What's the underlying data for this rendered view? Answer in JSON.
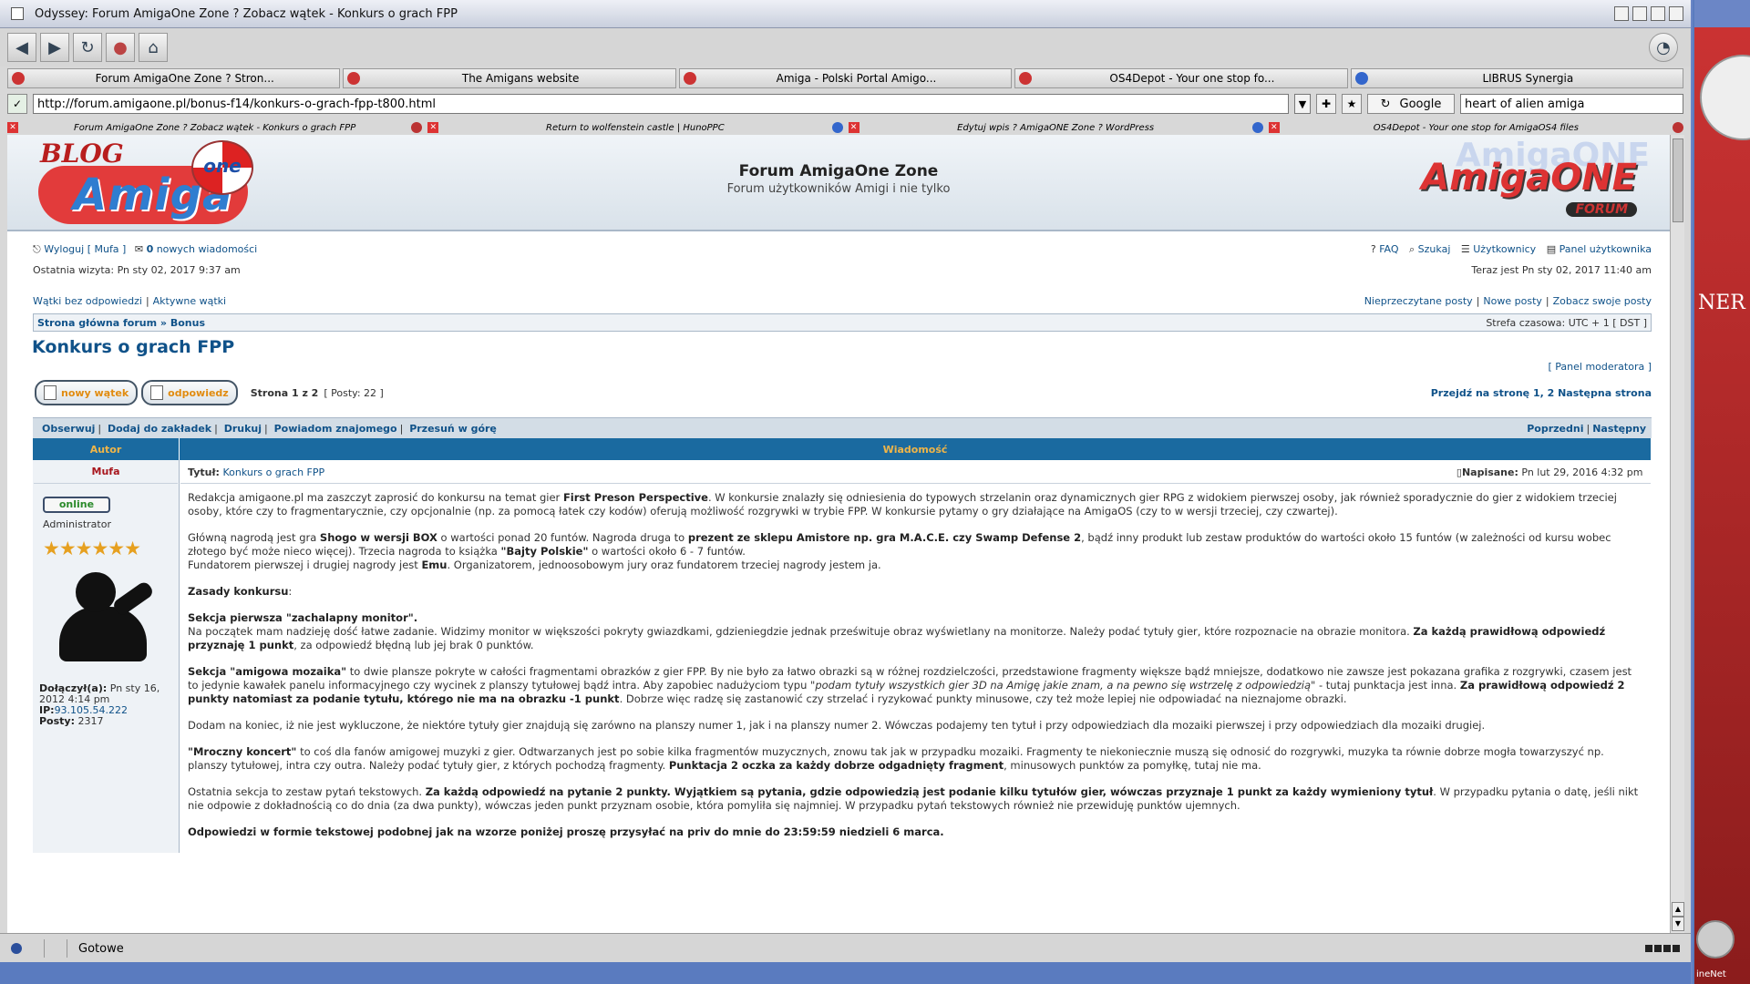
{
  "window": {
    "title": "Odyssey: Forum AmigaOne Zone ? Zobacz wątek - Konkurs o grach FPP"
  },
  "tabs": [
    {
      "label": "Forum AmigaOne Zone ? Stron...",
      "icon": "amiga-ball-icon"
    },
    {
      "label": "The Amigans website",
      "icon": "amiga-ball-icon"
    },
    {
      "label": "Amiga - Polski Portal Amigo...",
      "icon": "ppa-icon"
    },
    {
      "label": "OS4Depot - Your one stop fo...",
      "icon": "amiga-ball-icon"
    },
    {
      "label": "LIBRUS Synergia",
      "icon": "globe-icon"
    }
  ],
  "address": {
    "url": "http://forum.amigaone.pl/bonus-f14/konkurs-o-grach-fpp-t800.html",
    "search_engine": "Google",
    "search_query": "heart of alien amiga"
  },
  "subtabs": [
    {
      "label": "Forum AmigaOne Zone ? Zobacz wątek - Konkurs o grach FPP"
    },
    {
      "label": "Return to wolfenstein castle | HunoPPC"
    },
    {
      "label": "Edytuj wpis ? AmigaONE Zone ? WordPress"
    },
    {
      "label": "OS4Depot - Your one stop for AmigaOS4 files"
    }
  ],
  "header": {
    "logo_left_blog": "BLOG",
    "logo_left_one": "one",
    "logo_left_amiga": "Amiga",
    "site_title": "Forum AmigaOne Zone",
    "site_desc": "Forum użytkowników Amigi i nie tylko",
    "logo_right": "AmigaONE",
    "logo_right_ghost": "AmigaONE",
    "logo_right_forum": "FORUM"
  },
  "nav": {
    "logout": "Wyloguj [ Mufa ]",
    "new_count": "0",
    "new_messages": " nowych wiadomości",
    "faq": "FAQ",
    "search": "Szukaj",
    "members": "Użytkownicy",
    "ucp": "Panel użytkownika",
    "last_visit": "Ostatnia wizyta: Pn sty 02, 2017 9:37 am",
    "now": "Teraz jest Pn sty 02, 2017 11:40 am",
    "unanswered": "Wątki bez odpowiedzi",
    "active": "Aktywne wątki",
    "unread": "Nieprzeczytane posty",
    "new_posts": "Nowe posty",
    "own_posts": "Zobacz swoje posty",
    "crumb_home": "Strona główna forum",
    "crumb_sep": " » ",
    "crumb_forum": "Bonus",
    "timezone": "Strefa czasowa: UTC + 1 [ DST ]"
  },
  "topic": {
    "title": "Konkurs o grach FPP",
    "mod_panel": "[ Panel moderatora ]",
    "btn_new": "nowy wątek",
    "btn_reply": "odpowiedz",
    "page_status": "Strona 1 z 2",
    "posts": "[ Posty: 22 ]",
    "goto_page": "Przejdź na stronę 1, 2  Następna strona",
    "actions": [
      "Obserwuj",
      "Dodaj do zakładek",
      "Drukuj",
      "Powiadom znajomego",
      "Przesuń w górę"
    ],
    "prev": "Poprzedni",
    "next": "Następny"
  },
  "post": {
    "col_author": "Autor",
    "col_message": "Wiadomość",
    "author": "Mufa",
    "online": "online",
    "rank": "Administrator",
    "stars": "★★★★★★",
    "joined_label": "Dołączył(a):",
    "joined_value": "Pn sty 16, 2012 4:14 pm",
    "ip_label": "IP:",
    "ip_value": "93.105.54.222",
    "posts_label": "Posty:",
    "posts_value": "2317",
    "subject_label": "Tytuł:",
    "subject": "Konkurs o grach FPP",
    "posted_label": "Napisane:",
    "posted": "Pn lut 29, 2016 4:32 pm",
    "p1a": "Redakcja amigaone.pl ma zaszczyt zaprosić do konkursu na temat gier ",
    "p1b": "First Preson Perspective",
    "p1c": ". W konkursie znalazły się odniesienia do typowych strzelanin oraz dynamicznych gier RPG z widokiem pierwszej osoby, jak również sporadycznie do gier z widokiem trzeciej osoby, które czy to fragmentarycznie, czy opcjonalnie (np. za pomocą łatek czy kodów) oferują możliwość rozgrywki w trybie FPP. W konkursie pytamy o gry działające na AmigaOS (czy to w wersji trzeciej, czy czwartej).",
    "p2a": "Główną nagrodą jest gra ",
    "p2b": "Shogo w wersji BOX",
    "p2c": " o wartości ponad 20 funtów. Nagroda druga to ",
    "p2d": "prezent ze sklepu Amistore np. gra M.A.C.E. czy Swamp Defense 2",
    "p2e": ", bądź inny produkt lub zestaw produktów do wartości około 15 funtów (w zależności od kursu wobec złotego być może nieco więcej). Trzecia nagroda to książka ",
    "p2f": "\"Bajty Polskie\"",
    "p2g": " o wartości około 6 - 7 funtów.",
    "p2h": "Fundatorem pierwszej i drugiej nagrody jest ",
    "p2i": "Emu",
    "p2j": ". Organizatorem, jednoosobowym jury oraz fundatorem trzeciej nagrody jestem ja.",
    "p3": "Zasady konkursu",
    "p3b": ":",
    "p4a": "Sekcja pierwsza \"zachalapny monitor\".",
    "p4b": "Na początek mam nadzieję dość łatwe zadanie. Widzimy monitor w większości pokryty gwiazdkami, gdzieniegdzie jednak prześwituje obraz wyświetlany na monitorze. Należy podać tytuły gier, które rozpoznacie na obrazie monitora. ",
    "p4c": "Za każdą prawidłową odpowiedź przyznaję 1 punkt",
    "p4d": ", za odpowiedź błędną lub jej brak 0 punktów.",
    "p5a": "Sekcja \"amigowa mozaika\"",
    "p5b": " to dwie plansze pokryte w całości fragmentami obrazków z gier FPP. By nie było za łatwo obrazki są w różnej rozdzielczości, przedstawione fragmenty większe bądź mniejsze, dodatkowo nie zawsze jest pokazana grafika z rozgrywki, czasem jest to jedynie kawałek panelu informacyjnego czy wycinek z planszy tytułowej bądź intra. Aby zapobiec nadużyciom typu \"",
    "p5c": "podam tytuły wszystkich gier 3D na Amigę jakie znam, a na pewno się wstrzelę z odpowiedzią",
    "p5d": "\" - tutaj punktacja jest inna. ",
    "p5e": "Za prawidłową odpowiedź 2 punkty natomiast za podanie tytułu, którego nie ma na obrazku -1 punkt",
    "p5f": ". Dobrze więc radzę się zastanowić czy strzelać i ryzykować punkty minusowe, czy też może lepiej nie odpowiadać na nieznajome obrazki.",
    "p6": "Dodam na koniec, iż nie jest wykluczone, że niektóre tytuły gier znajdują się zarówno na planszy numer 1, jak i na planszy numer 2. Wówczas podajemy ten tytuł i przy odpowiedziach dla mozaiki pierwszej i przy odpowiedziach dla mozaiki drugiej.",
    "p7a": "\"Mroczny koncert\"",
    "p7b": " to coś dla fanów amigowej muzyki z gier. Odtwarzanych jest po sobie kilka fragmentów muzycznych, znowu tak jak w przypadku mozaiki. Fragmenty te niekoniecznie muszą się odnosić do rozgrywki, muzyka ta równie dobrze mogła towarzyszyć np. planszy tytułowej, intra czy outra. Należy podać tytuły gier, z których pochodzą fragmenty. ",
    "p7c": "Punktacja 2 oczka za każdy dobrze odgadnięty fragment",
    "p7d": ", minusowych punktów za pomyłkę, tutaj nie ma.",
    "p8a": "Ostatnia sekcja to zestaw pytań tekstowych. ",
    "p8b": "Za każdą odpowiedź na pytanie 2 punkty. Wyjątkiem są pytania, gdzie odpowiedzią jest podanie kilku tytułów gier, wówczas przyznaje 1 punkt za każdy wymieniony tytuł",
    "p8c": ". W przypadku pytania o datę, jeśli nikt nie odpowie z dokładnością co do dnia (za dwa punkty), wówczas jeden punkt przyznam osobie, która pomyliła się najmniej. W przypadku pytań tekstowych również nie przewiduję punktów ujemnych.",
    "p9": "Odpowiedzi w formie tekstowej podobnej jak na wzorze poniżej proszę przysyłać na priv do mnie do 23:59:59 niedzieli 6 marca."
  },
  "status": {
    "text": "Gotowe"
  },
  "desktop": {
    "partial_text": "NER",
    "net": "ineNet"
  }
}
